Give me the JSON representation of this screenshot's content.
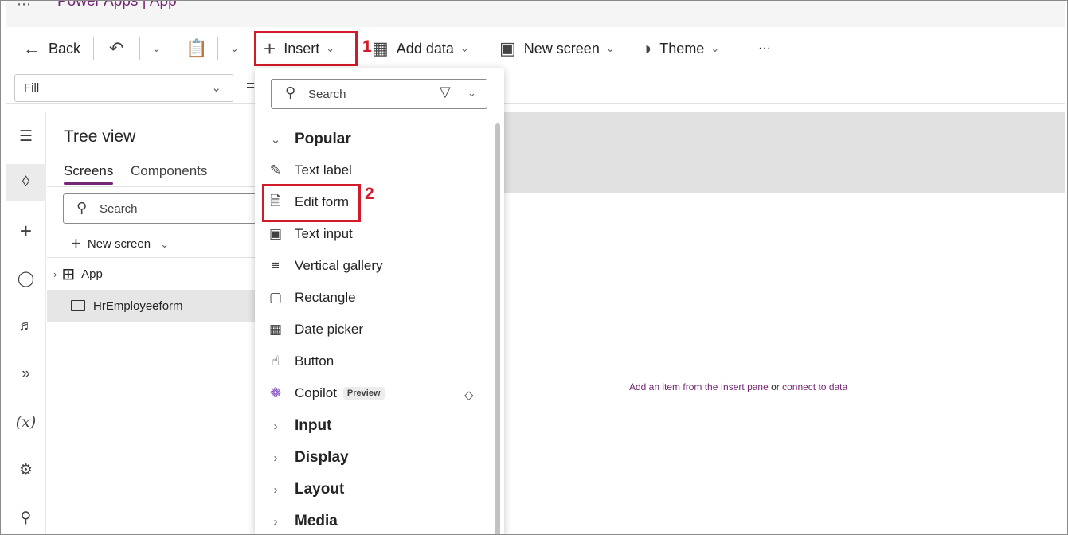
{
  "app": {
    "dots": "⋯",
    "title": "Power Apps  |  App"
  },
  "commandbar": {
    "back_label": "Back",
    "insert_label": "Insert",
    "add_data_label": "Add data",
    "new_screen_label": "New screen",
    "theme_label": "Theme",
    "more_label": "···"
  },
  "annotations": {
    "step1": "1",
    "step2": "2"
  },
  "formula": {
    "property": "Fill",
    "equals": "="
  },
  "tree": {
    "title": "Tree view",
    "tabs": [
      "Screens",
      "Components"
    ],
    "search_placeholder": "Search",
    "new_screen": "New screen",
    "nodes": [
      "App",
      "HrEmployeeform"
    ]
  },
  "insert_menu": {
    "search_placeholder": "Search",
    "popular_label": "Popular",
    "items": [
      "Text label",
      "Edit form",
      "Text input",
      "Vertical gallery",
      "Rectangle",
      "Date picker",
      "Button",
      "Copilot"
    ],
    "copilot_badge": "Preview",
    "categories": [
      "Input",
      "Display",
      "Layout",
      "Media"
    ]
  },
  "canvas": {
    "hint_part1": "Add an item from the Insert pane",
    "hint_or": " or ",
    "hint_part2": "connect to data"
  }
}
